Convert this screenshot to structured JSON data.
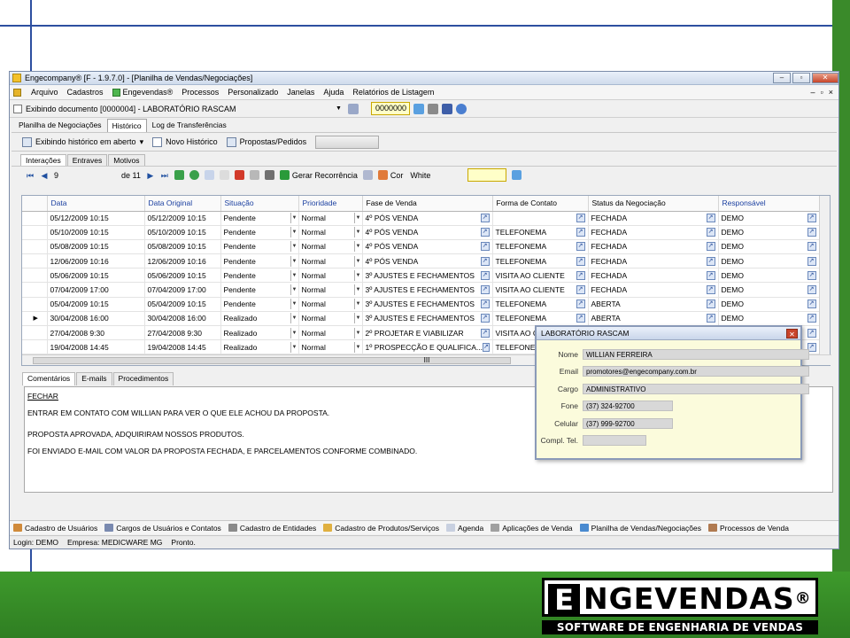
{
  "window": {
    "title": "Engecompany® [F - 1.9.7.0] - [Planilha de Vendas/Negociações]",
    "minimize_glyph": "–",
    "restore_glyph": "▫",
    "close_glyph": "✕"
  },
  "menu": {
    "items": [
      "Arquivo",
      "Cadastros",
      "Engevendas®",
      "Processos",
      "Personalizado",
      "Janelas",
      "Ajuda",
      "Relatórios de Listagem"
    ],
    "mdi": [
      "–",
      "▫",
      "×"
    ]
  },
  "docbar": {
    "text": "Exibindo documento [0000004] - LABORATÓRIO RASCAM",
    "dropdown": "▼",
    "number": "0000000"
  },
  "top_tabs": [
    "Planilha de Negociações",
    "Histórico",
    "Log de Transferências"
  ],
  "history_toolbar": {
    "show_history": "Exibindo histórico em aberto",
    "dropdown": "▾",
    "new_history": "Novo Histórico",
    "proposals": "Propostas/Pedidos"
  },
  "inner_tabs": [
    "Interações",
    "Entraves",
    "Motivos"
  ],
  "nav": {
    "first": "⏮",
    "prev": "◀",
    "current": "9",
    "of_label": "de 11",
    "next": "▶",
    "last": "⏭",
    "recurrence": "Gerar Recorrência",
    "color_label": "Cor",
    "color_value": "White"
  },
  "grid": {
    "columns": [
      "Data",
      "Data Original",
      "Situação",
      "Prioridade",
      "Fase de Venda",
      "Forma de Contato",
      "Status da Negociação",
      "Responsável"
    ],
    "current_row": 7,
    "rows": [
      {
        "data": "05/12/2009 10:15",
        "orig": "05/12/2009 10:15",
        "sit": "Pendente",
        "prio": "Normal",
        "fase": "4º PÓS VENDA",
        "forma": "",
        "status": "FECHADA",
        "resp": "DEMO"
      },
      {
        "data": "05/10/2009 10:15",
        "orig": "05/10/2009 10:15",
        "sit": "Pendente",
        "prio": "Normal",
        "fase": "4º PÓS VENDA",
        "forma": "TELEFONEMA",
        "status": "FECHADA",
        "resp": "DEMO"
      },
      {
        "data": "05/08/2009 10:15",
        "orig": "05/08/2009 10:15",
        "sit": "Pendente",
        "prio": "Normal",
        "fase": "4º PÓS VENDA",
        "forma": "TELEFONEMA",
        "status": "FECHADA",
        "resp": "DEMO"
      },
      {
        "data": "12/06/2009 10:16",
        "orig": "12/06/2009 10:16",
        "sit": "Pendente",
        "prio": "Normal",
        "fase": "4º PÓS VENDA",
        "forma": "TELEFONEMA",
        "status": "FECHADA",
        "resp": "DEMO"
      },
      {
        "data": "05/06/2009 10:15",
        "orig": "05/06/2009 10:15",
        "sit": "Pendente",
        "prio": "Normal",
        "fase": "3º AJUSTES E FECHAMENTOS",
        "forma": "VISITA AO CLIENTE",
        "status": "FECHADA",
        "resp": "DEMO"
      },
      {
        "data": "07/04/2009 17:00",
        "orig": "07/04/2009 17:00",
        "sit": "Pendente",
        "prio": "Normal",
        "fase": "3º AJUSTES E FECHAMENTOS",
        "forma": "VISITA AO CLIENTE",
        "status": "FECHADA",
        "resp": "DEMO"
      },
      {
        "data": "05/04/2009 10:15",
        "orig": "05/04/2009 10:15",
        "sit": "Pendente",
        "prio": "Normal",
        "fase": "3º AJUSTES E FECHAMENTOS",
        "forma": "TELEFONEMA",
        "status": "ABERTA",
        "resp": "DEMO"
      },
      {
        "data": "30/04/2008 16:00",
        "orig": "30/04/2008 16:00",
        "sit": "Realizado",
        "prio": "Normal",
        "fase": "3º AJUSTES E FECHAMENTOS",
        "forma": "TELEFONEMA",
        "status": "ABERTA",
        "resp": "DEMO"
      },
      {
        "data": "27/04/2008 9:30",
        "orig": "27/04/2008 9:30",
        "sit": "Realizado",
        "prio": "Normal",
        "fase": "2º PROJETAR E VIABILIZAR",
        "forma": "VISITA AO C",
        "status": "",
        "resp": ""
      },
      {
        "data": "19/04/2008 14:45",
        "orig": "19/04/2008 14:45",
        "sit": "Realizado",
        "prio": "Normal",
        "fase": "1º PROSPECÇÃO E QUALIFICA...",
        "forma": "TELEFONE",
        "status": "",
        "resp": ""
      }
    ],
    "hscroll_label": "III"
  },
  "bottom_tabs": [
    "Comentários",
    "E-mails",
    "Procedimentos"
  ],
  "notes": {
    "link": "FECHAR",
    "lines": [
      "ENTRAR EM CONTATO COM WILLIAN PARA VER O QUE ELE ACHOU DA PROPOSTA.",
      "PROPOSTA APROVADA, ADQUIRIRAM NOSSOS PRODUTOS.",
      "FOI ENVIADO E-MAIL COM VALOR DA PROPOSTA FECHADA, E PARCELAMENTOS CONFORME COMBINADO."
    ]
  },
  "shortcuts": [
    "Cadastro de Usuários",
    "Cargos de Usuários e Contatos",
    "Cadastro de Entidades",
    "Cadastro de Produtos/Serviços",
    "Agenda",
    "Aplicações de Venda",
    "Planilha de Vendas/Negociações",
    "Processos de Venda"
  ],
  "status": {
    "login": "Login: DEMO",
    "company": "Empresa: MEDICWARE MG",
    "state": "Pronto."
  },
  "popup": {
    "title": "LABORATÓRIO RASCAM",
    "close": "✕",
    "fields": [
      {
        "label": "Nome",
        "value": "WILLIAN FERREIRA"
      },
      {
        "label": "Email",
        "value": "promotores@engecompany.com.br"
      },
      {
        "label": "Cargo",
        "value": "ADMINISTRATIVO"
      },
      {
        "label": "Fone",
        "value": "(37) 324-92700"
      },
      {
        "label": "Celular",
        "value": "(37) 999-92700"
      },
      {
        "label": "Compl. Tel.",
        "value": ""
      }
    ]
  },
  "logo": {
    "mark": "E",
    "word": "NGEVENDAS",
    "reg": "®",
    "tagline": "SOFTWARE DE ENGENHARIA DE VENDAS"
  },
  "colors": {
    "slide_blue": "#2d4fa0",
    "slide_green": "#3e9a2c",
    "header_link": "#1a3fa0",
    "input_yellow": "#ffffc8"
  }
}
